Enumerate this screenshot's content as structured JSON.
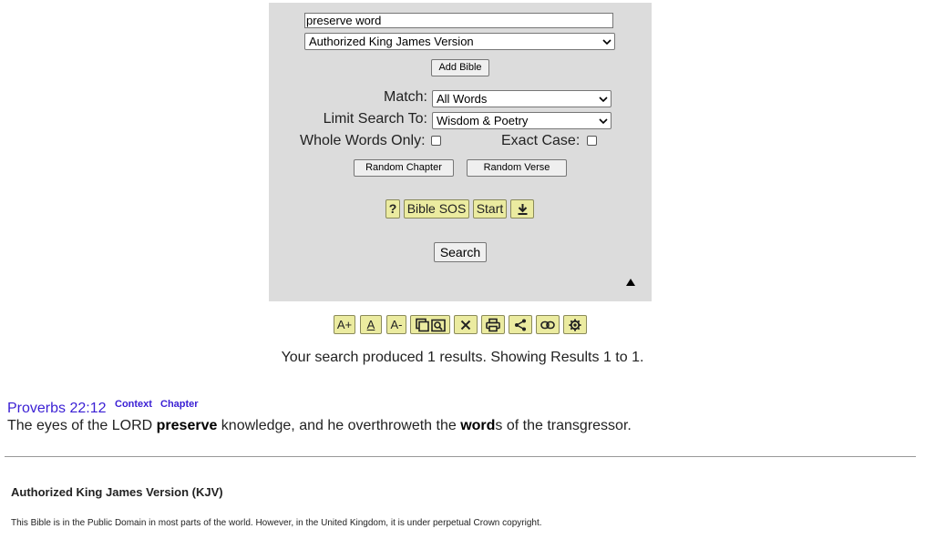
{
  "search": {
    "query": "preserve word",
    "version": "Authorized King James Version",
    "add_bible": "Add Bible",
    "match_label": "Match:",
    "match_value": "All Words",
    "limit_label": "Limit Search To:",
    "limit_value": "Wisdom & Poetry",
    "whole_words_label": "Whole Words Only:",
    "whole_words_checked": false,
    "exact_case_label": "Exact Case:",
    "exact_case_checked": false,
    "random_chapter": "Random Chapter",
    "random_verse": "Random Verse",
    "help": "?",
    "bible_sos": "Bible SOS",
    "start": "Start",
    "search_button": "Search",
    "download_icon": "download-icon",
    "collapse_icon": "triangle-up-icon"
  },
  "toolbar": {
    "increase_font": "A+",
    "reset_font": "A",
    "decrease_font": "A-",
    "icons": [
      "copy-preview-icon",
      "close-icon",
      "print-icon",
      "share-icon",
      "link-icon",
      "settings-icon"
    ]
  },
  "results": {
    "summary": "Your search produced 1 results.  Showing Results 1 to 1.",
    "items": [
      {
        "reference": "Proverbs 22:12",
        "context_link": "Context",
        "chapter_link": "Chapter",
        "text_part1": "The eyes of the LORD ",
        "highlight1": "preserve",
        "text_part2": " knowledge, and he overthroweth the ",
        "highlight2": "word",
        "text_part3": "s of the transgressor."
      }
    ]
  },
  "footer": {
    "version_title": "Authorized King James Version (KJV)",
    "copyright": "This Bible is in the Public Domain in most parts of the world.  However, in the United Kingdom, it is under perpetual Crown copyright."
  },
  "colors": {
    "panel_bg": "#dcdcdc",
    "button_yellow": "#ebeba0",
    "link_blue": "#3a1fd4"
  }
}
